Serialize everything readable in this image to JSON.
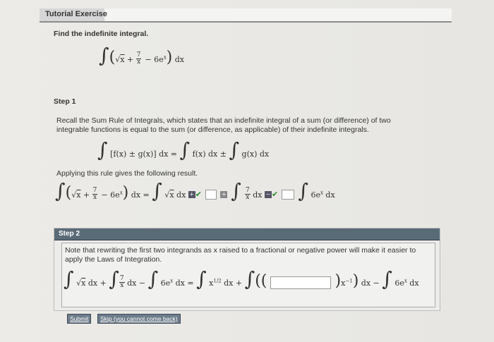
{
  "header": {
    "title": "Tutorial Exercise"
  },
  "problem": {
    "prompt": "Find the indefinite integral.",
    "expression": "∫(√x + 7/x − 6eˣ) dx"
  },
  "step1": {
    "title": "Step 1",
    "text1": "Recall the Sum Rule of Integrals, which states that an indefinite integral of a sum (or difference) of two",
    "text2": "integrable functions is equal to the sum (or difference, as applicable) of their indefinite integrals.",
    "rule": "∫ [f(x) ± g(x)] dx = ∫ f(x) dx ± ∫ g(x) dx",
    "apply_text": "Applying this rule gives the following result.",
    "result": "∫(√x + 7/x − 6eˣ) dx = ∫ √x dx"
  },
  "step2": {
    "title": "Step 2",
    "text1": "Note that rewriting the first two integrands as x raised to a fractional or negative power will make it easier to",
    "text2": "apply the Laws of Integration.",
    "equation": "∫ √x dx + ∫ 7/x dx − ∫ 6eˣ dx = ∫ x^{1/2} dx + ∫(( ) x^{−1}) dx − ∫ 6eˣ dx"
  },
  "buttons": {
    "submit": "Submit",
    "skip": "Skip (you cannot come back)"
  }
}
